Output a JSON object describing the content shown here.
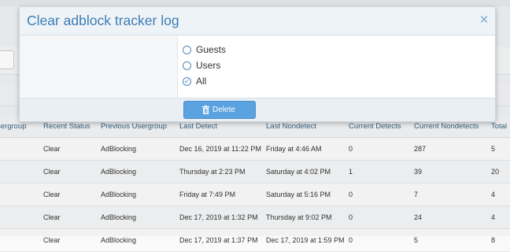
{
  "dialog": {
    "title": "Clear adblock tracker log",
    "close_glyph": "×",
    "options": [
      {
        "label": "Guests",
        "checked": false
      },
      {
        "label": "Users",
        "checked": false
      },
      {
        "label": "All",
        "checked": true
      }
    ],
    "checked_glyph": "✓",
    "delete_label": "Delete",
    "delete_icon": "trash-icon"
  },
  "colors": {
    "title": "#3d7cb3",
    "button": "#5aa2e0",
    "header_text": "#36627e"
  },
  "table": {
    "columns": [
      "sergroup",
      "Recent Status",
      "Previous Usergroup",
      "Last Detect",
      "Last Nondetect",
      "Current Detects",
      "Current Nondetects",
      "Total"
    ],
    "rows": [
      [
        "",
        "Clear",
        "AdBlocking",
        "Dec 16, 2019 at 11:22 PM",
        "Friday at 4:46 AM",
        "0",
        "287",
        "5"
      ],
      [
        "",
        "Clear",
        "AdBlocking",
        "Thursday at 2:23 PM",
        "Saturday at 4:02 PM",
        "1",
        "39",
        "20"
      ],
      [
        "",
        "Clear",
        "AdBlocking",
        "Friday at 7:49 PM",
        "Saturday at 5:16 PM",
        "0",
        "7",
        "4"
      ],
      [
        "",
        "Clear",
        "AdBlocking",
        "Dec 17, 2019 at 1:32 PM",
        "Thursday at 9:02 PM",
        "0",
        "24",
        "4"
      ],
      [
        "",
        "Clear",
        "AdBlocking",
        "Dec 17, 2019 at 1:37 PM",
        "Dec 17, 2019 at 1:59 PM",
        "0",
        "5",
        "8"
      ]
    ]
  }
}
